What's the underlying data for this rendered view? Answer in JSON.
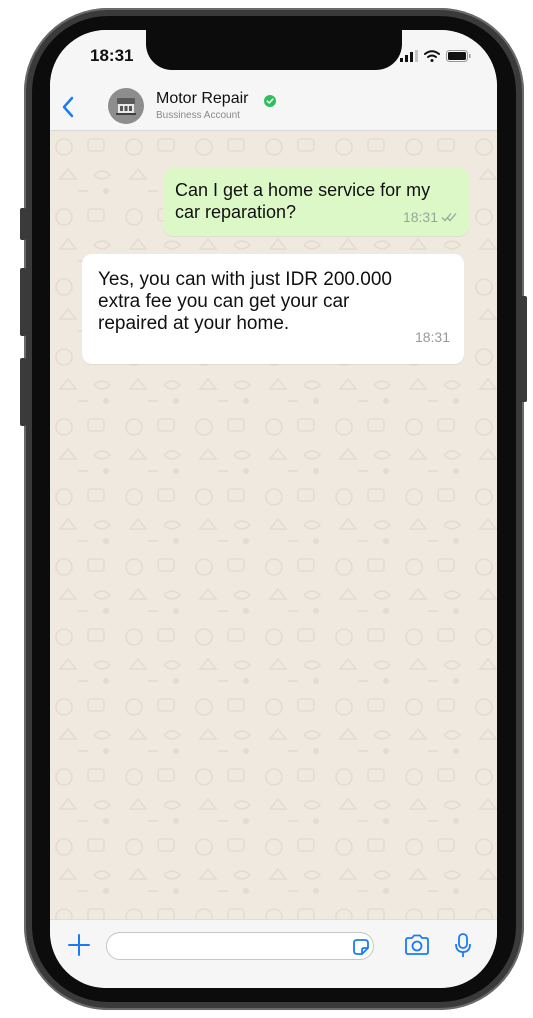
{
  "status_bar": {
    "time": "18:31"
  },
  "header": {
    "contact_name": "Motor Repair",
    "subtitle": "Bussiness Account"
  },
  "messages": [
    {
      "direction": "outgoing",
      "text": "Can I get a home service for my\ncar reparation?",
      "time": "18:31",
      "status": "read"
    },
    {
      "direction": "incoming",
      "text": "Yes, you can with just IDR 200.000\nextra fee you can get your car\nrepaired at your home.",
      "time": "18:31"
    }
  ],
  "input_bar": {
    "placeholder": ""
  },
  "colors": {
    "accent": "#1a7cf5",
    "outgoing_bubble": "#dcf8c6",
    "incoming_bubble": "#ffffff",
    "chat_background": "#efe9df",
    "verified": "#2fbf5f"
  },
  "icons": [
    "back-icon",
    "verified-icon",
    "plus-icon",
    "sticker-icon",
    "camera-icon",
    "microphone-icon",
    "signal-icon",
    "wifi-icon",
    "battery-icon"
  ]
}
